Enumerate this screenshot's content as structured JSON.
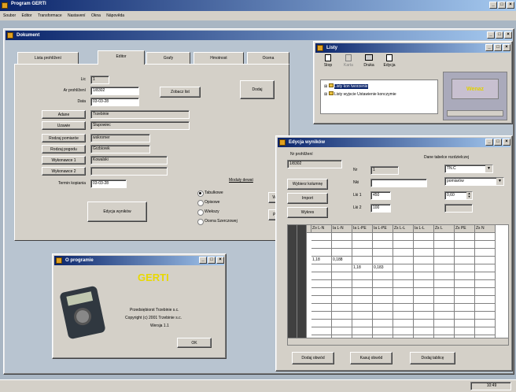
{
  "app": {
    "title": "Program GERTI",
    "menu": [
      "Soubor",
      "Editor",
      "Transformace",
      "Nastavení",
      "Okna",
      "Nápověda"
    ]
  },
  "main_window": {
    "title": "Dokument"
  },
  "editor": {
    "tabs": [
      "Lista prohlížení",
      "Editor",
      "Grafy",
      "Hmotnost",
      "Ocena"
    ],
    "fields": [
      {
        "label": "Lic",
        "value": "1",
        "type": "gray"
      },
      {
        "label": "Ar prohlížení",
        "value": "1/8302",
        "type": "white"
      },
      {
        "label": "Data",
        "value": "03-03-28",
        "type": "white"
      },
      {
        "label": "Adane",
        "value": "Trzebinie",
        "type": "gray",
        "btn": true
      },
      {
        "label": "Uzawie",
        "value": "Slupowiec",
        "type": "gray",
        "btn": true
      },
      {
        "label": "Rodzaj pomiaróe",
        "value": "wskromer",
        "type": "gray",
        "btn": true
      },
      {
        "label": "Rodzaj pogodu",
        "value": "Grzbiorek",
        "type": "gray",
        "btn": true
      },
      {
        "label": "Wykonawce 1",
        "value": "Kowalski",
        "type": "gray",
        "btn": true
      },
      {
        "label": "Wykonawce 2",
        "value": "",
        "type": "gray",
        "btn": true
      },
      {
        "label": "Termin kopiania",
        "value": "03-03-28",
        "type": "white"
      }
    ],
    "zobacz_label": "Zobacz list",
    "dodaj_label": "Dodaj",
    "modul_label": "Moduły dewat",
    "radios": [
      "Tabulkowe",
      "Opisowe",
      "Wiekszy",
      "Ocena Szerczowej"
    ],
    "btn_edycja": "Edycja wyników",
    "side_btns": [
      "Wy",
      "Po"
    ]
  },
  "lists": {
    "title": "Listy",
    "toolbar": [
      "Stop",
      "Karta",
      "Druka",
      "Edycja"
    ],
    "tree": [
      "Listy kon tworzenie",
      "Listy wyjscie Ustawienie konczymie"
    ],
    "preview_text": "Wenaz"
  },
  "measure": {
    "title": "Edycja wyników",
    "nr_label": "Nr prohlížení",
    "nr_value": "1/8302",
    "btns": [
      "Wybierz kolumnę",
      "Import",
      "Wykres"
    ],
    "table_header_label": "Dane tabelce rozdzielczej",
    "fields": [
      {
        "label": "Nr",
        "value": "1"
      },
      {
        "label": "Nki",
        "value": ""
      },
      {
        "label": "Lki 1",
        "value": "450"
      },
      {
        "label": "Lki 2",
        "value": "100"
      }
    ],
    "selects": [
      "TN.C",
      "pomiarów"
    ],
    "spin_value": "0,60",
    "columns": [
      "Zo L-N",
      "Ia L-N",
      "Ia L-PE",
      "Ia L-PE",
      "Zs L-L",
      "Ia L-L",
      "Zs L",
      "Zs PE",
      "Zs N"
    ],
    "rows": [
      [
        "",
        "",
        "",
        "",
        "",
        "",
        "",
        "",
        ""
      ],
      [
        "",
        "",
        "",
        "",
        "",
        "",
        "",
        "",
        ""
      ],
      [
        "",
        "",
        "",
        "",
        "",
        "",
        "",
        "",
        ""
      ],
      [
        "1,18",
        "0,188",
        "",
        "",
        "",
        "",
        "",
        "",
        ""
      ],
      [
        "",
        "",
        "1,18",
        "0,183",
        "",
        "",
        "",
        "",
        ""
      ],
      [
        "",
        "",
        "",
        "",
        "",
        "",
        "",
        "",
        ""
      ],
      [
        "",
        "",
        "",
        "",
        "",
        "",
        "",
        "",
        ""
      ],
      [
        "",
        "",
        "",
        "",
        "",
        "",
        "",
        "",
        ""
      ],
      [
        "",
        "",
        "",
        "",
        "",
        "",
        "",
        "",
        ""
      ],
      [
        "",
        "",
        "",
        "",
        "",
        "",
        "",
        "",
        ""
      ],
      [
        "",
        "",
        "",
        "",
        "",
        "",
        "",
        "",
        ""
      ],
      [
        "",
        "",
        "",
        "",
        "",
        "",
        "",
        "",
        ""
      ],
      [
        "",
        "",
        "",
        "",
        "",
        "",
        "",
        "",
        ""
      ],
      [
        "",
        "",
        "",
        "",
        "",
        "",
        "",
        "",
        ""
      ]
    ],
    "bottom_btns": [
      "Dodaj obwód",
      "Kasuj obwód",
      "Dodaj tablicę"
    ]
  },
  "about": {
    "title": "O programie",
    "logo": "GERTI",
    "lines": [
      "Przedsiębiorst Trzebinie s.c.",
      "Copyright (c) 2001 Trzebinie s.c.",
      "Wersja 1.1"
    ],
    "ok": "OK"
  },
  "statusbar": {
    "clock": "10:49"
  }
}
